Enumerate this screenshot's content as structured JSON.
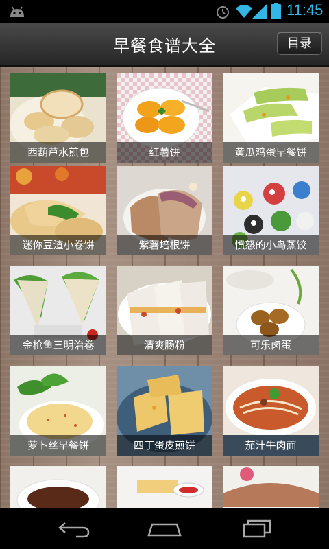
{
  "status": {
    "time": "11:45"
  },
  "header": {
    "title": "早餐食谱大全",
    "menu_label": "目录"
  },
  "recipes": [
    {
      "name": "西葫芦水煎包"
    },
    {
      "name": "红薯饼"
    },
    {
      "name": "黄瓜鸡蛋早餐饼"
    },
    {
      "name": "迷你豆渣小卷饼"
    },
    {
      "name": "紫薯培根饼"
    },
    {
      "name": "愤怒的小鸟蒸饺"
    },
    {
      "name": "金枪鱼三明治卷"
    },
    {
      "name": "清爽肠粉"
    },
    {
      "name": "可乐卤蛋"
    },
    {
      "name": "萝卜丝早餐饼"
    },
    {
      "name": "四丁蛋皮煎饼"
    },
    {
      "name": "茄汁牛肉面"
    },
    {
      "name": ""
    },
    {
      "name": ""
    },
    {
      "name": ""
    }
  ],
  "icons": {
    "status": [
      "android-icon",
      "alarm-icon",
      "wifi-icon",
      "signal-icon",
      "battery-icon"
    ],
    "nav": [
      "back-icon",
      "home-icon",
      "recent-apps-icon"
    ]
  },
  "colors": {
    "status_accent": "#33b5e5",
    "caption_bg": "rgba(0,0,0,0.55)"
  }
}
